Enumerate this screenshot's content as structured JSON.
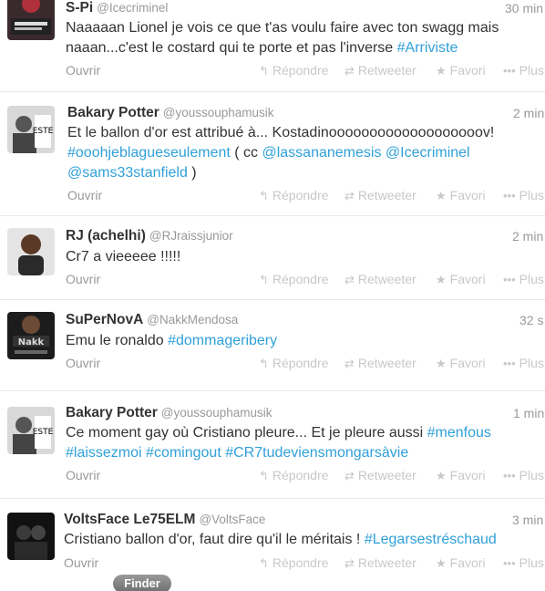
{
  "actions": {
    "open": "Ouvrir",
    "reply": "Répondre",
    "retweet": "Retweeter",
    "favorite": "Favori",
    "more": "Plus"
  },
  "tweets": [
    {
      "name": "S-Pi",
      "handle": "@Icecriminel",
      "time": "30 min",
      "line1": "Naaaaan Lionel je vois ce que t'as voulu faire avec ton swagg mais",
      "line2_text": "naaan...c'est le costard qui te porte et pas l'inverse ",
      "line2_hash": "#Arriviste"
    },
    {
      "name": "Bakary Potter",
      "handle": "@youssouphamusik",
      "time": "2 min",
      "line1": "Et le ballon d'or est attribué à... Kostadinooooooooooooooooooov!",
      "line2_hash": "#ooohjeblagueseulement",
      "line2_text": " ( cc ",
      "line2_m1": "@lassananemesis",
      "line2_m2": "@Icecriminel",
      "line3_m": "@sams33stanfield",
      "line3_text": " )"
    },
    {
      "name": "RJ (achelhi)",
      "handle": "@RJraissjunior",
      "time": "2 min",
      "line1": "Cr7 a vieeeee !!!!!"
    },
    {
      "name": "SuPerNovA",
      "handle": "@NakkMendosa",
      "time": "32 s",
      "line1_text": "Emu le ronaldo ",
      "line1_hash": "#dommageribery"
    },
    {
      "name": "Bakary Potter",
      "handle": "@youssouphamusik",
      "time": "1 min",
      "line1_text": "Ce moment gay où Cristiano pleure... Et je pleure aussi ",
      "line1_hash": "#menfous",
      "line2_h1": "#laissezmoi",
      "line2_h2": "#comingout",
      "line2_h3": "#CR7tudeviensmongarsàvie"
    },
    {
      "name": "VoltsFace Le75ELM",
      "handle": "@VoltsFace",
      "time": "3 min",
      "line1_text": "Cristiano ballon d'or, faut dire qu'il le méritais ! ",
      "line1_hash": "#Legarsestréschaud"
    }
  ],
  "dock": {
    "finder_label": "Finder"
  }
}
